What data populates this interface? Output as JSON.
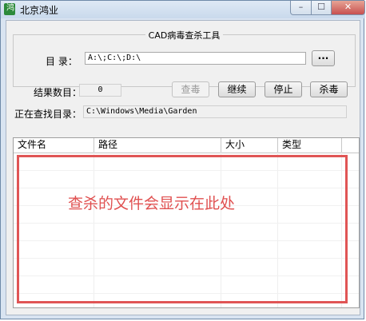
{
  "window": {
    "title": "北京鸿业",
    "app_icon_glyph": "鸿"
  },
  "controls": {
    "minimize": "–",
    "maximize": "☐",
    "close": "✕"
  },
  "group": {
    "title": "CAD病毒查杀工具",
    "dir_label": "目 录：",
    "dir_value": "A:\\;C:\\;D:\\",
    "browse_label": "···"
  },
  "results": {
    "count_label": "结果数目：",
    "count_value": "0"
  },
  "buttons": {
    "scan": "查毒",
    "continue": "继续",
    "stop": "停止",
    "kill": "杀毒"
  },
  "searching": {
    "label": "正在查找目录：",
    "value": "C:\\Windows\\Media\\Garden"
  },
  "table": {
    "columns": [
      "文件名",
      "路径",
      "大小",
      "类型"
    ]
  },
  "annotation": "查杀的文件会显示在此处",
  "colors": {
    "highlight": "#e05555",
    "annotation_text": "#e05050"
  }
}
